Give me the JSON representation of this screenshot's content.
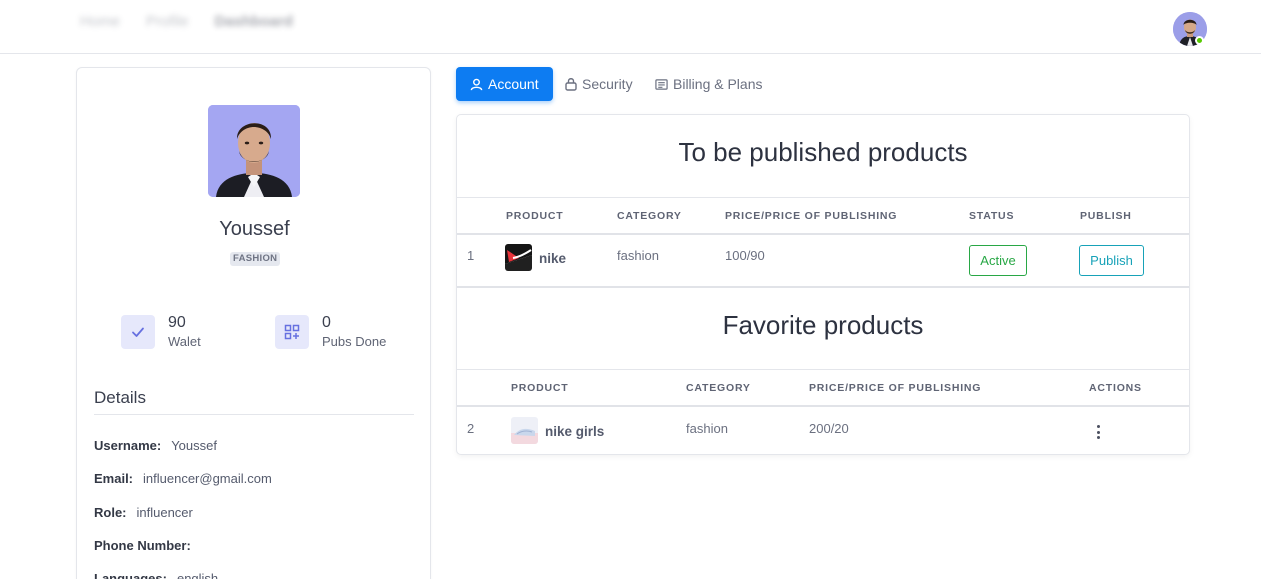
{
  "navbar": {
    "breadcrumbs": [
      "Home",
      "Profile",
      "Dashboard"
    ]
  },
  "profile": {
    "name": "Youssef",
    "role_badge": "FASHION",
    "stats": [
      {
        "value": "90",
        "label": "Walet",
        "icon": "check-icon"
      },
      {
        "value": "0",
        "label": "Pubs Done",
        "icon": "grid-plus-icon"
      }
    ],
    "details_title": "Details",
    "details": [
      {
        "label": "Username:",
        "value": "Youssef"
      },
      {
        "label": "Email:",
        "value": "influencer@gmail.com"
      },
      {
        "label": "Role:",
        "value": "influencer"
      },
      {
        "label": "Phone Number:",
        "value": ""
      },
      {
        "label": "Languages:",
        "value": "english"
      }
    ]
  },
  "tabs": [
    {
      "label": "Account",
      "icon": "user-icon",
      "active": true
    },
    {
      "label": "Security",
      "icon": "lock-icon",
      "active": false
    },
    {
      "label": "Billing & Plans",
      "icon": "receipt-icon",
      "active": false
    }
  ],
  "to_publish": {
    "title": "To be published products",
    "columns": [
      "PRODUCT",
      "CATEGORY",
      "PRICE/PRICE OF PUBLISHING",
      "STATUS",
      "PUBLISH"
    ],
    "rows": [
      {
        "index": "1",
        "product": "nike",
        "category": "fashion",
        "price": "100/90",
        "status": "Active",
        "publish": "Publish"
      }
    ]
  },
  "favorites": {
    "title": "Favorite products",
    "columns": [
      "PRODUCT",
      "CATEGORY",
      "PRICE/PRICE OF PUBLISHING",
      "ACTIONS"
    ],
    "rows": [
      {
        "index": "2",
        "product": "nike girls",
        "category": "fashion",
        "price": "200/20"
      }
    ]
  },
  "colors": {
    "primary": "#0d7cf2",
    "success": "#28a745",
    "info": "#17a2b8",
    "avatar_bg": "#a4a6f2"
  }
}
